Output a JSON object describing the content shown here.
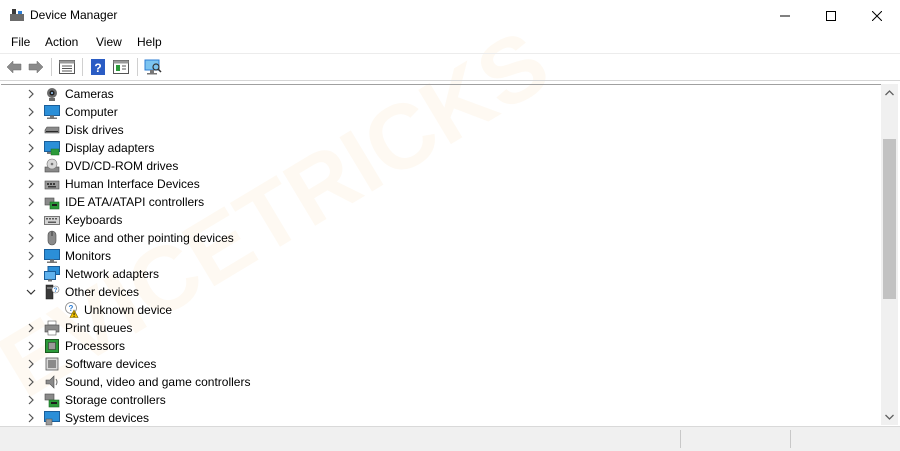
{
  "window": {
    "title": "Device Manager",
    "icon": "device-manager-icon",
    "controls": [
      "minimize-icon",
      "maximize-icon",
      "close-icon"
    ]
  },
  "menu": {
    "items": [
      {
        "label": "File"
      },
      {
        "label": "Action"
      },
      {
        "label": "View"
      },
      {
        "label": "Help"
      }
    ]
  },
  "toolbar": {
    "buttons": [
      "back-icon",
      "forward-icon",
      "properties-icon",
      "help-icon",
      "update-driver-icon",
      "scan-hardware-icon"
    ]
  },
  "tree": {
    "items": [
      {
        "label": "Cameras",
        "icon": "camera-icon",
        "expanded": false
      },
      {
        "label": "Computer",
        "icon": "computer-icon",
        "expanded": false
      },
      {
        "label": "Disk drives",
        "icon": "disk-drive-icon",
        "expanded": false
      },
      {
        "label": "Display adapters",
        "icon": "display-adapter-icon",
        "expanded": false
      },
      {
        "label": "DVD/CD-ROM drives",
        "icon": "dvd-drive-icon",
        "expanded": false
      },
      {
        "label": "Human Interface Devices",
        "icon": "hid-icon",
        "expanded": false
      },
      {
        "label": "IDE ATA/ATAPI controllers",
        "icon": "ide-controller-icon",
        "expanded": false
      },
      {
        "label": "Keyboards",
        "icon": "keyboard-icon",
        "expanded": false
      },
      {
        "label": "Mice and other pointing devices",
        "icon": "mouse-icon",
        "expanded": false
      },
      {
        "label": "Monitors",
        "icon": "monitor-icon",
        "expanded": false
      },
      {
        "label": "Network adapters",
        "icon": "network-adapter-icon",
        "expanded": false
      },
      {
        "label": "Other devices",
        "icon": "other-devices-icon",
        "expanded": true
      },
      {
        "label": "Unknown device",
        "icon": "unknown-device-warning-icon",
        "child": true
      },
      {
        "label": "Print queues",
        "icon": "printer-icon",
        "expanded": false
      },
      {
        "label": "Processors",
        "icon": "processor-icon",
        "expanded": false
      },
      {
        "label": "Software devices",
        "icon": "software-device-icon",
        "expanded": false
      },
      {
        "label": "Sound, video and game controllers",
        "icon": "speaker-icon",
        "expanded": false
      },
      {
        "label": "Storage controllers",
        "icon": "storage-controller-icon",
        "expanded": false
      },
      {
        "label": "System devices",
        "icon": "system-devices-icon",
        "expanded": false
      }
    ]
  },
  "watermark": {
    "text": "EVICETRICKS",
    "color": "#f7a440"
  },
  "colors": {
    "accent_blue": "#2b7cd3",
    "warning_yellow": "#f5c400"
  }
}
